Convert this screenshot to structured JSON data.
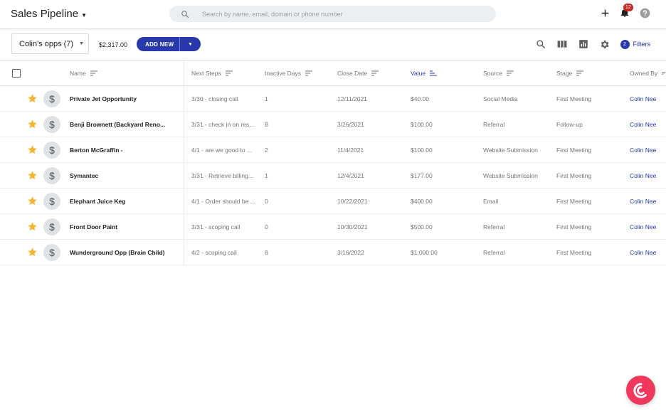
{
  "header": {
    "title": "Sales Pipeline",
    "search_placeholder": "Search by name, email, domain or phone number",
    "notification_count": "12"
  },
  "toolbar": {
    "view_label": "Colin's opps (7)",
    "total_value": "$2,317.00",
    "add_new_label": "ADD NEW",
    "filter_count": "2",
    "filters_label": "Filters"
  },
  "columns": {
    "name": "Name",
    "next_steps": "Next Steps",
    "inactive_days": "Inactive Days",
    "close_date": "Close Date",
    "value": "Value",
    "source": "Source",
    "stage": "Stage",
    "owned_by": "Owned By"
  },
  "rows": [
    {
      "name": "Private Jet Opportunity",
      "next_steps": "3/30 - closing call",
      "inactive_days": "1",
      "close_date": "12/11/2021",
      "value": "$40.00",
      "source": "Social Media",
      "stage": "First Meeting",
      "owner": "Colin Nee"
    },
    {
      "name": "Benji Brownett (Backyard Reno...",
      "next_steps": "3/31 - check in on res...",
      "inactive_days": "8",
      "close_date": "3/26/2021",
      "value": "$100.00",
      "source": "Referral",
      "stage": "Follow-up",
      "owner": "Colin Nee"
    },
    {
      "name": "Berton McGraffin -",
      "next_steps": "4/1 - are we good to ...",
      "inactive_days": "2",
      "close_date": "11/4/2021",
      "value": "$100.00",
      "source": "Website Submission",
      "stage": "First Meeting",
      "owner": "Colin Nee"
    },
    {
      "name": "Symantec",
      "next_steps": "3/31 - Retrieve billing...",
      "inactive_days": "1",
      "close_date": "12/4/2021",
      "value": "$177.00",
      "source": "Website Submission",
      "stage": "First Meeting",
      "owner": "Colin Nee"
    },
    {
      "name": "Elephant Juice Keg",
      "next_steps": "4/1 - Order should be ...",
      "inactive_days": "0",
      "close_date": "10/22/2021",
      "value": "$400.00",
      "source": "Email",
      "stage": "First Meeting",
      "owner": "Colin Nee"
    },
    {
      "name": "Front Door Paint",
      "next_steps": "3/31 - scoping call",
      "inactive_days": "0",
      "close_date": "10/30/2021",
      "value": "$500.00",
      "source": "Referral",
      "stage": "First Meeting",
      "owner": "Colin Nee"
    },
    {
      "name": "Wunderground Opp (Brain Child)",
      "next_steps": "4/2 - scoping call",
      "inactive_days": "8",
      "close_date": "3/16/2022",
      "value": "$1,000.00",
      "source": "Referral",
      "stage": "First Meeting",
      "owner": "Colin Nee"
    }
  ],
  "colors": {
    "accent": "#2938ad",
    "star": "#f4b731",
    "fab": "#f0385c",
    "badge": "#c62828"
  }
}
